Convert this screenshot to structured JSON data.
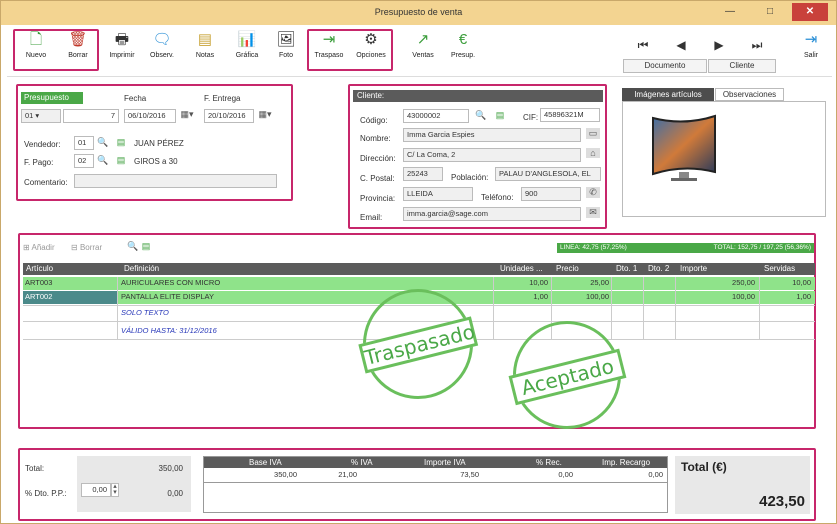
{
  "window": {
    "title": "Presupuesto de venta",
    "minimize": "—",
    "maximize": "□",
    "close": "✕"
  },
  "toolbar": [
    {
      "label": "Nuevo",
      "icon": "🗋"
    },
    {
      "label": "Borrar",
      "icon": "🗑"
    },
    {
      "label": "Imprimir",
      "icon": "🖶"
    },
    {
      "label": "Observ.",
      "icon": "🗨"
    },
    {
      "label": "Notas",
      "icon": "▤"
    },
    {
      "label": "Gráfica",
      "icon": "📊"
    },
    {
      "label": "Foto",
      "icon": "🖼"
    },
    {
      "label": "Traspaso",
      "icon": "⇥"
    },
    {
      "label": "Opciones",
      "icon": "⚙"
    },
    {
      "label": "Ventas",
      "icon": "↗"
    },
    {
      "label": "Presup.",
      "icon": "€"
    }
  ],
  "nav": {
    "first": "⏮",
    "prev": "◀",
    "next": "▶",
    "last": "⏭",
    "tab_documento": "Documento",
    "tab_cliente": "Cliente",
    "exit_label": "Salir",
    "exit_icon": "⇥"
  },
  "doc": {
    "tab": "Presupuesto",
    "serie": "01",
    "numero": "7",
    "fecha_label": "Fecha",
    "fecha": "06/10/2016",
    "entrega_label": "F. Entrega",
    "entrega": "20/10/2016",
    "vendedor_label": "Vendedor:",
    "vendedor_code": "01",
    "vendedor_name": "JUAN PÉREZ",
    "pago_label": "F. Pago:",
    "pago_code": "02",
    "pago_name": "GIROS a 30",
    "comentario_label": "Comentario:",
    "comentario": ""
  },
  "cliente": {
    "header": "Cliente:",
    "codigo_label": "Código:",
    "codigo": "43000002",
    "cif_label": "CIF:",
    "cif": "45896321M",
    "nombre_label": "Nombre:",
    "nombre": "Imma Garcia Espies",
    "direccion_label": "Dirección:",
    "direccion": "C/ La Coma, 2",
    "postal_label": "C. Postal:",
    "postal": "25243",
    "poblacion_label": "Población:",
    "poblacion": "PALAU D'ANGLESOLA, EL",
    "provincia_label": "Provincia:",
    "provincia": "LLEIDA",
    "telefono_label": "Teléfono:",
    "telefono": "900",
    "email_label": "Email:",
    "email": "imma.garcia@sage.com"
  },
  "side_tabs": {
    "imagenes": "Imágenes artículos",
    "observaciones": "Observaciones"
  },
  "lines": {
    "add_label": "Añadir",
    "delete_label": "Borrar",
    "linea_status": "LINEA: 42,75 (57,25%)",
    "total_status": "TOTAL: 152,75 / 197,25 (56,36%)",
    "columns": [
      "Artículo",
      "Definición",
      "Unidades ...",
      "Precio",
      "Dto. 1",
      "Dto. 2",
      "Importe",
      "Servidas"
    ],
    "rows": [
      {
        "articulo": "ART003",
        "definicion": "AURICULARES CON MICRO",
        "unidades": "10,00",
        "precio": "25,00",
        "dto1": "",
        "dto2": "",
        "importe": "250,00",
        "servidas": "10,00"
      },
      {
        "articulo": "ART002",
        "definicion": "PANTALLA ELITE DISPLAY",
        "unidades": "1,00",
        "precio": "100,00",
        "dto1": "",
        "dto2": "",
        "importe": "100,00",
        "servidas": "1,00"
      },
      {
        "articulo": "",
        "definicion": "SOLO TEXTO",
        "unidades": "",
        "precio": "",
        "dto1": "",
        "dto2": "",
        "importe": "",
        "servidas": ""
      },
      {
        "articulo": "",
        "definicion": "VÁLIDO HASTA: 31/12/2016",
        "unidades": "",
        "precio": "",
        "dto1": "",
        "dto2": "",
        "importe": "",
        "servidas": ""
      }
    ],
    "stamp1": "Traspasado",
    "stamp2": "Aceptado"
  },
  "totals": {
    "total_label": "Total:",
    "total_value": "350,00",
    "dto_label": "% Dto. P.P.:",
    "dto_pct": "0,00",
    "dto_value": "0,00",
    "iva_columns": [
      "Base IVA",
      "% IVA",
      "Importe IVA",
      "% Rec.",
      "Imp. Recargo"
    ],
    "iva_row": [
      "350,00",
      "21,00",
      "73,50",
      "0,00",
      "0,00"
    ],
    "grand_label": "Total (€)",
    "grand_value": "423,50"
  }
}
